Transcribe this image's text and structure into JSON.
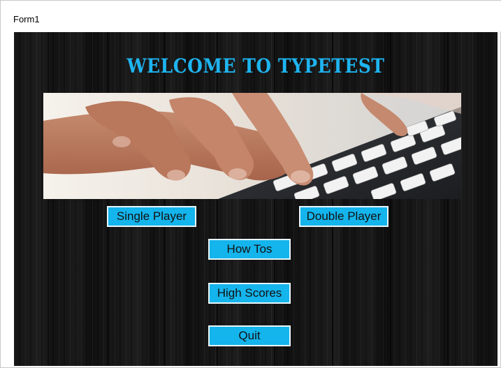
{
  "window": {
    "title": "Form1"
  },
  "main": {
    "heading": "WELCOME TO TYPETEST",
    "banner_image": "hands-typing-on-keyboard",
    "buttons": {
      "single_player": "Single Player",
      "double_player": "Double Player",
      "how_tos": "How Tos",
      "high_scores": "High Scores",
      "quit": "Quit"
    }
  },
  "colors": {
    "accent": "#14b4ec",
    "heading": "#1eb4f0",
    "background": "#151515"
  }
}
